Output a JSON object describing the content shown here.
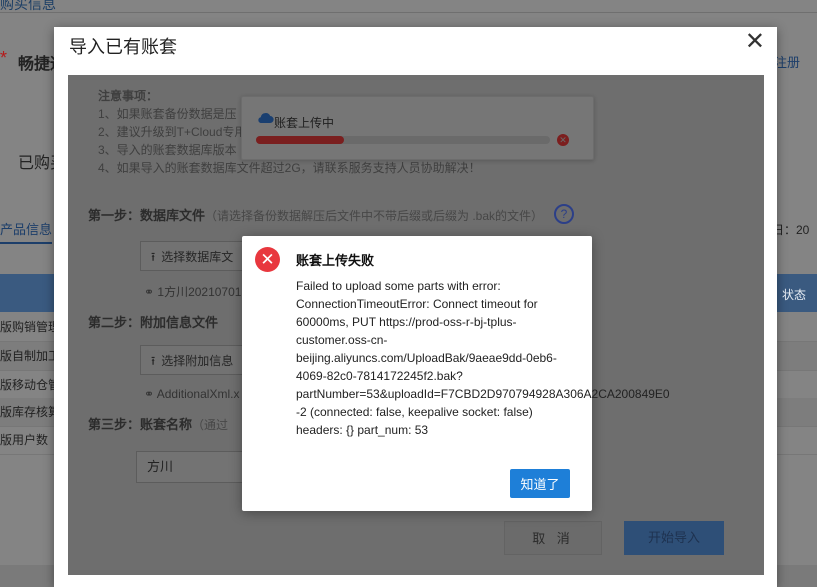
{
  "background": {
    "top_tab": "购买信息",
    "star": "*",
    "page_title": "畅捷通",
    "register_link": "注册",
    "bought_label": "已购买",
    "product_tab": "产品信息",
    "date_label": "日：20",
    "status_header": "状态",
    "rows": [
      "版购销管理",
      "版自制加工",
      "版移动仓管",
      "版库存核算",
      "版用户数"
    ]
  },
  "dialog": {
    "title": "导入已有账套",
    "close": "✕",
    "notes": {
      "title": "注意事项：",
      "lines": [
        "1、如果账套备份数据是压",
        "2、建议升级到T+Cloud专用",
        "3、导入的账套数据库版本",
        "4、如果导入的账套数据库文件超过2G，请联系服务支持人员协助解决！"
      ]
    },
    "step1": {
      "label": "第一步：数据库文件",
      "hint": "（请选择备份数据解压后文件中不带后缀或后缀为 .bak的文件）",
      "help": "?",
      "button": "选择数据库文",
      "file": "1方川20210701"
    },
    "step2": {
      "label": "第二步：附加信息文件",
      "button": "选择附加信息",
      "file": "AdditionalXml.x"
    },
    "step3": {
      "label": "第三步：账套名称",
      "hint": "（通过",
      "value": "方川"
    },
    "cancel": "取 消",
    "start": "开始导入"
  },
  "upload": {
    "text": "账套上传中",
    "progress": 0.3
  },
  "error": {
    "title": "账套上传失败",
    "message_lines": [
      "Failed to upload some parts with error:",
      "ConnectionTimeoutError: Connect timeout for",
      "60000ms, PUT https://prod-oss-r-bj-tplus-",
      "customer.oss-cn-",
      "beijing.aliyuncs.com/UploadBak/9aeae9dd-0eb6-",
      "4069-82c0-7814172245f2.bak?",
      "partNumber=53&uploadId=F7CBD2D970794928A306A2CA200849E0",
      "-2 (connected: false, keepalive socket: false)",
      "headers: {} part_num: 53"
    ],
    "ok": "知道了"
  },
  "colors": {
    "error_red": "#e8373e",
    "primary_blue": "#1e7fd8"
  }
}
